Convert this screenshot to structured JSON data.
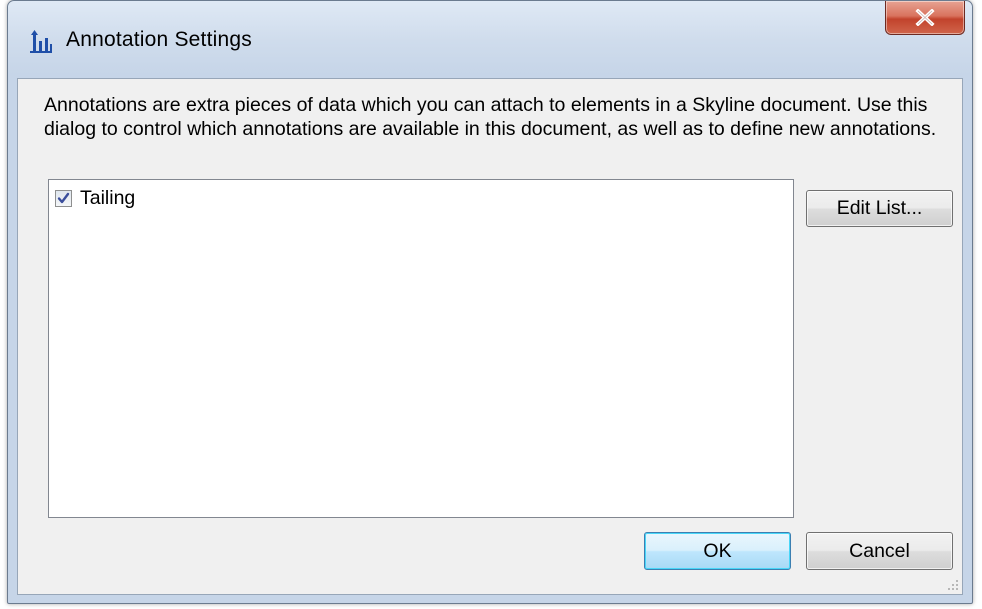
{
  "window": {
    "title": "Annotation Settings"
  },
  "dialog": {
    "description": "Annotations are extra pieces of data which you can attach to elements in a Skyline document. Use this dialog to control which annotations are available in this document, as well as to define new annotations.",
    "annotations": [
      {
        "label": "Tailing",
        "checked": true
      }
    ],
    "buttons": {
      "edit_list": "Edit List...",
      "ok": "OK",
      "cancel": "Cancel"
    }
  },
  "icons": {
    "app": "skyline-chart-icon",
    "close": "close-icon",
    "check": "checkmark-icon",
    "grip": "resize-grip-icon"
  },
  "colors": {
    "close_button": "#c2432c",
    "title_bar": "#cfdcec",
    "client_background": "#f0f0f0",
    "ok_button_border": "#3c7fb1",
    "checkmark": "#3a4e9c",
    "app_icon": "#1f4fa8"
  }
}
